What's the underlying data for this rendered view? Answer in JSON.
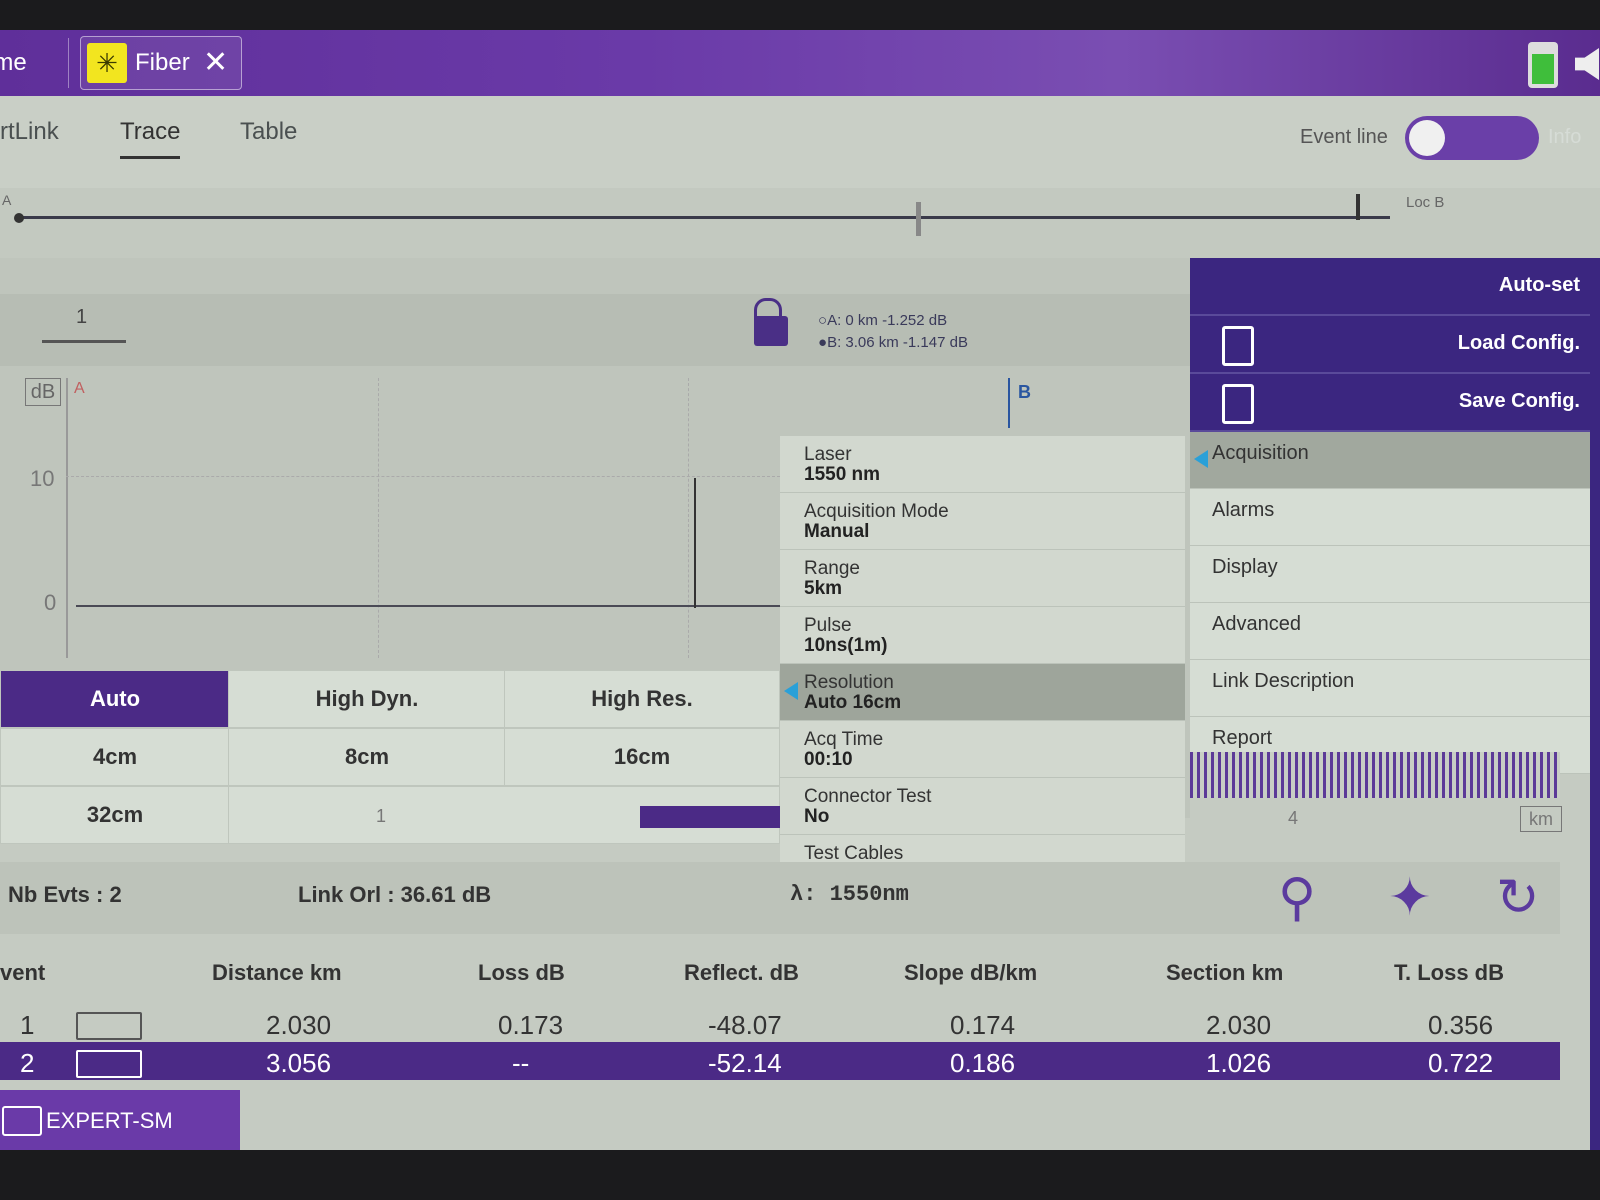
{
  "titlebar": {
    "home_tab": "ome",
    "fiber_tab": "Fiber",
    "close_symbol": "✕"
  },
  "subtabs": {
    "smartlink": "rtLink",
    "trace": "Trace",
    "table": "Table",
    "event_line_label": "Event line",
    "info_label": "Info"
  },
  "overview": {
    "a_label": "A",
    "locb_label": "Loc B"
  },
  "trace": {
    "trace_number": "1",
    "cursor_a": "A: 0 km -1.252 dB",
    "cursor_b": "B: 3.06 km -1.147 dB",
    "y_unit": "dB",
    "y_tick_10": "10",
    "y_tick_0": "0",
    "marker_a": "A",
    "marker_b": "B",
    "x_tick_1": "1",
    "x_tick_4": "4",
    "x_unit": "km"
  },
  "resolution_options": {
    "auto": "Auto",
    "high_dyn": "High Dyn.",
    "high_res": "High Res.",
    "r4cm": "4cm",
    "r8cm": "8cm",
    "r16cm": "16cm",
    "r32cm": "32cm"
  },
  "params": [
    {
      "label": "Laser",
      "value": "1550 nm"
    },
    {
      "label": "Acquisition Mode",
      "value": "Manual"
    },
    {
      "label": "Range",
      "value": "5km"
    },
    {
      "label": "Pulse",
      "value": "10ns(1m)"
    },
    {
      "label": "Resolution",
      "value": "Auto 16cm"
    },
    {
      "label": "Acq Time",
      "value": "00:10"
    },
    {
      "label": "Connector Test",
      "value": "No"
    },
    {
      "label": "Test Cables",
      "value": "<"
    }
  ],
  "menu": {
    "auto_set": "Auto-set",
    "load_config": "Load Config.",
    "save_config": "Save Config.",
    "items": [
      "Acquisition",
      "Alarms",
      "Display",
      "Advanced",
      "Link Description",
      "Report"
    ]
  },
  "summary": {
    "nb_evts": "Nb Evts : 2",
    "link_orl": "Link Orl :  36.61 dB",
    "lambda": "λ:  1550nm"
  },
  "table": {
    "headers": [
      "vent",
      "Distance  km",
      "Loss dB",
      "Reflect. dB",
      "Slope  dB/km",
      "Section km",
      "T. Loss dB"
    ],
    "rows": [
      [
        "1",
        "2.030",
        "0.173",
        "-48.07",
        "0.174",
        "2.030",
        "0.356"
      ],
      [
        "2",
        "3.056",
        "--",
        "-52.14",
        "0.186",
        "1.026",
        "0.722"
      ]
    ]
  },
  "footer": {
    "mode": "EXPERT-SM"
  }
}
